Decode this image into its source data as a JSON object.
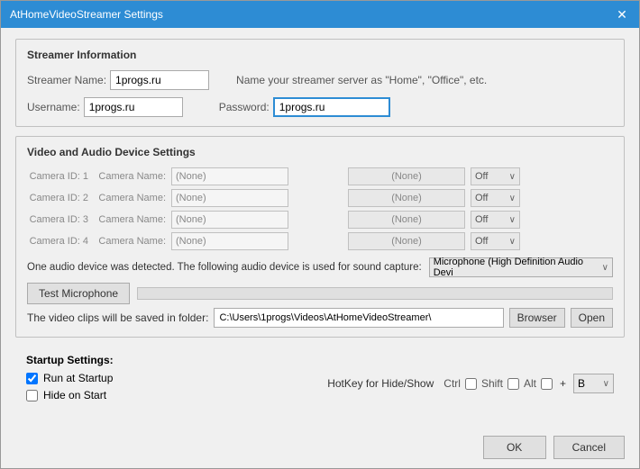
{
  "window": {
    "title": "AtHomeVideoStreamer Settings",
    "close_label": "✕"
  },
  "streamer_info": {
    "section_title": "Streamer Information",
    "streamer_name_label": "Streamer Name:",
    "streamer_name_value": "1progs.ru",
    "username_label": "Username:",
    "username_value": "1progs.ru",
    "hint": "Name your streamer server as \"Home\", \"Office\", etc.",
    "password_label": "Password:",
    "password_value": "1progs.ru"
  },
  "video_audio": {
    "section_title": "Video and Audio Device Settings",
    "cameras": [
      {
        "id": "Camera ID: 1",
        "name_label": "Camera Name:",
        "name_value": "(None)",
        "select_value": "(None)",
        "off": "Off"
      },
      {
        "id": "Camera ID: 2",
        "name_label": "Camera Name:",
        "name_value": "(None)",
        "select_value": "(None)",
        "off": "Off"
      },
      {
        "id": "Camera ID: 3",
        "name_label": "Camera Name:",
        "name_value": "(None)",
        "select_value": "(None)",
        "off": "Off"
      },
      {
        "id": "Camera ID: 4",
        "name_label": "Camera Name:",
        "name_value": "(None)",
        "select_value": "(None)",
        "off": "Off"
      }
    ],
    "audio_text": "One audio device was detected.  The following audio device is used for sound capture:",
    "audio_device": "Microphone (High Definition Audio Devi",
    "test_mic_label": "Test Microphone",
    "folder_label": "The video clips will be saved in folder:",
    "folder_path": "C:\\Users\\1progs\\Videos\\AtHomeVideoStreamer\\",
    "browser_label": "Browser",
    "open_label": "Open"
  },
  "startup": {
    "section_title": "Startup Settings:",
    "run_at_startup_label": "Run at Startup",
    "run_at_startup_checked": true,
    "hide_on_start_label": "Hide on Start",
    "hide_on_start_checked": false,
    "hotkey_label": "HotKey for Hide/Show",
    "ctrl_label": "Ctrl",
    "shift_label": "Shift",
    "alt_label": "Alt",
    "plus_label": "+",
    "hotkey_value": "B"
  },
  "footer": {
    "ok_label": "OK",
    "cancel_label": "Cancel"
  }
}
